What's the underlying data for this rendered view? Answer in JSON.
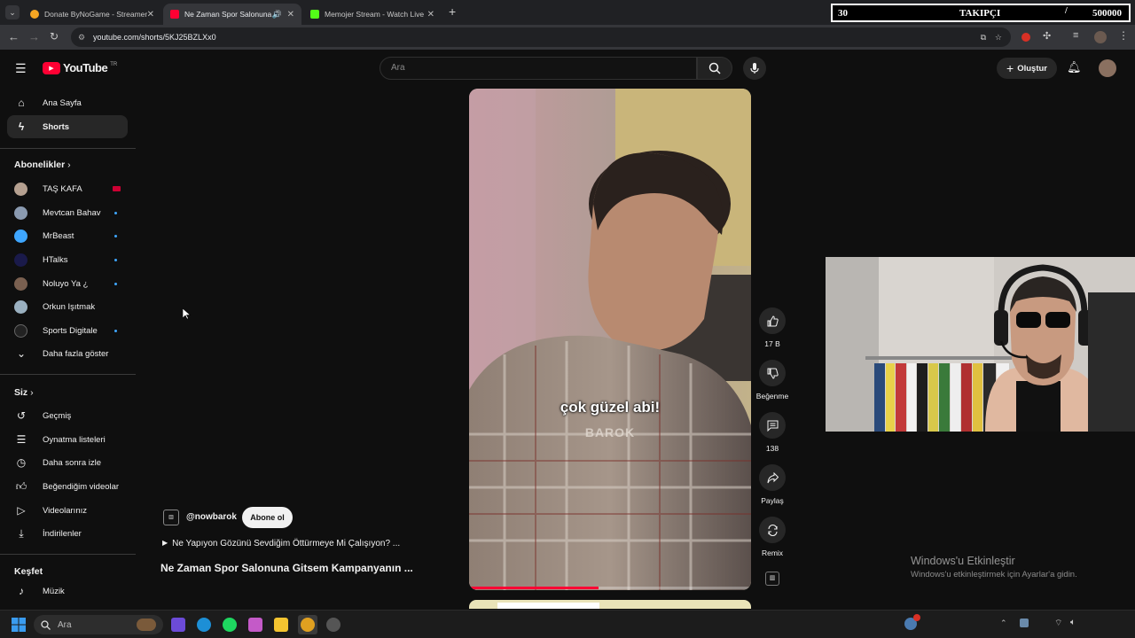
{
  "browser": {
    "tabs": [
      {
        "title": "Donate ByNoGame - Streamer"
      },
      {
        "title": "Ne Zaman Spor Salonuna G"
      },
      {
        "title": "Memojer Stream - Watch Live"
      }
    ],
    "url": "youtube.com/shorts/5KJ25BZLXx0",
    "new_tab": "+"
  },
  "overlay": {
    "count": "30",
    "label": "TAKIPÇI",
    "separator": "/",
    "goal": "500000"
  },
  "youtube": {
    "logo": "YouTube",
    "region": "TR",
    "search_placeholder": "Ara",
    "create_label": "Oluştur",
    "nav": [
      {
        "label": "Ana Sayfa",
        "icon": "home-icon"
      },
      {
        "label": "Shorts",
        "icon": "shorts-icon"
      }
    ],
    "subscriptions_heading": "Abonelikler",
    "subscriptions": [
      {
        "label": "TAŞ KAFA",
        "color": "#b5a090",
        "badge": "live"
      },
      {
        "label": "Mevtcan Bahav",
        "color": "#8a9ab0",
        "badge": "dot"
      },
      {
        "label": "MrBeast",
        "color": "#3ea6ff",
        "badge": "dot"
      },
      {
        "label": "HTalks",
        "color": "#1a1a4a",
        "badge": "dot"
      },
      {
        "label": "Noluyo Ya ¿",
        "color": "#7a6050",
        "badge": "dot"
      },
      {
        "label": "Orkun Işıtmak",
        "color": "#9ab0c0",
        "badge": "none"
      },
      {
        "label": "Sports Digitale",
        "color": "#222222",
        "badge": "dot"
      }
    ],
    "show_more": "Daha fazla göster",
    "you_heading": "Siz",
    "you_items": [
      {
        "label": "Geçmiş",
        "icon": "history-icon"
      },
      {
        "label": "Oynatma listeleri",
        "icon": "playlist-icon"
      },
      {
        "label": "Daha sonra izle",
        "icon": "clock-icon"
      },
      {
        "label": "Beğendiğim videolar",
        "icon": "thumbs-up-icon"
      },
      {
        "label": "Videolarınız",
        "icon": "video-icon"
      },
      {
        "label": "İndirilenler",
        "icon": "download-icon"
      }
    ],
    "explore_heading": "Keşfet",
    "explore_items": [
      {
        "label": "Müzik",
        "icon": "music-icon"
      }
    ],
    "short": {
      "channel": "@nowbarok",
      "subscribe": "Abone ol",
      "playlist": "Ne Yapıyon Gözünü Sevdiğim Öttürmeye Mi Çalışıyon? ...",
      "title": "Ne Zaman Spor Salonuna Gitsem Kampanyanın ...",
      "subtitle": "çok güzel abi!",
      "watermark": "BAROK",
      "likes": "17 B",
      "dislike_label": "Beğenme",
      "comments": "138",
      "share_label": "Paylaş",
      "remix_label": "Remix",
      "progress": 0.46
    }
  },
  "windows": {
    "activate_title": "Windows'u Etkinleştir",
    "activate_sub": "Windows'u etkinleştirmek için Ayarlar'a gidin.",
    "search": "Ara"
  },
  "colors": {
    "accent_red": "#ff0033",
    "chrome_dark": "#202124",
    "yt_bg": "#0f0f0f",
    "link_blue": "#3ea6ff"
  }
}
